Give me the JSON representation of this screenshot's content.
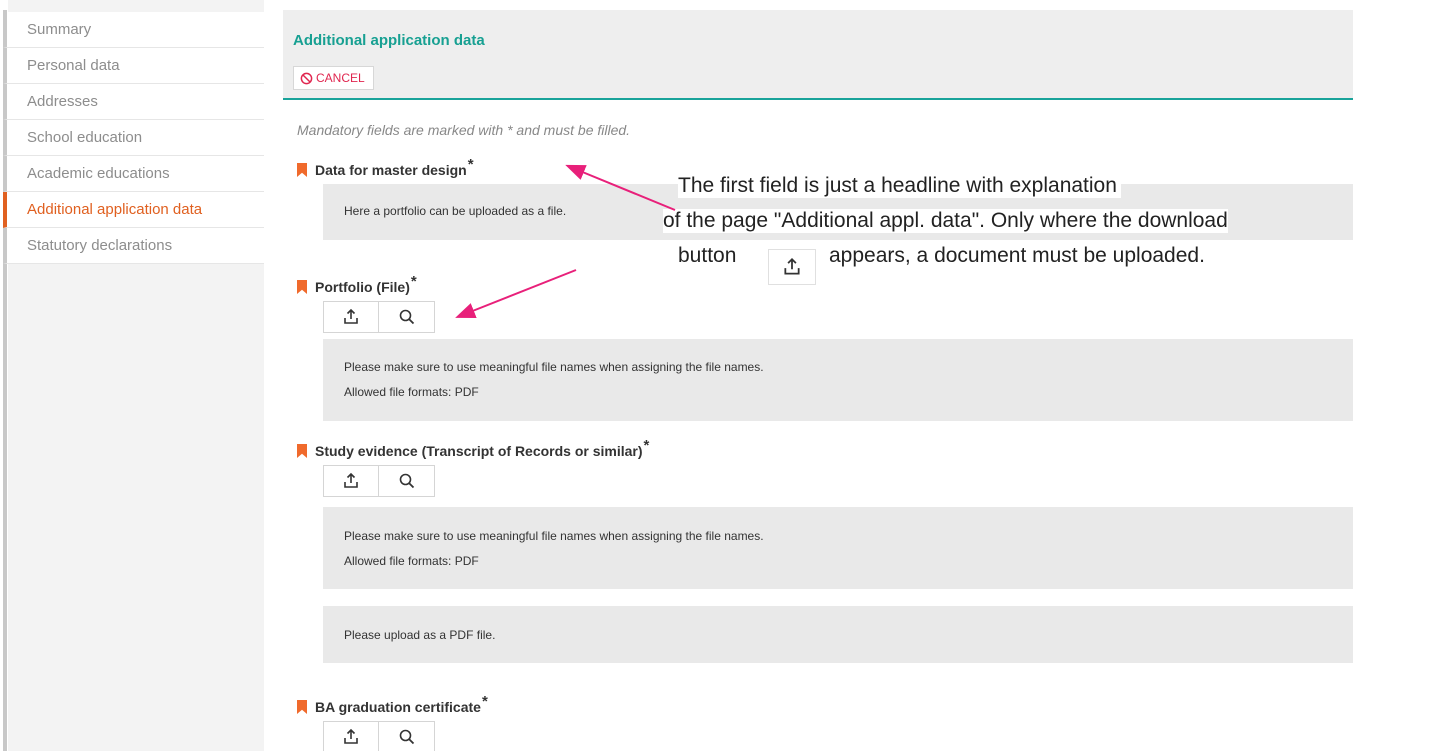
{
  "sidebar": {
    "items": [
      {
        "label": "Summary"
      },
      {
        "label": "Personal data"
      },
      {
        "label": "Addresses"
      },
      {
        "label": "School education"
      },
      {
        "label": "Academic educations"
      },
      {
        "label": "Additional application data",
        "active": true
      },
      {
        "label": "Statutory declarations"
      }
    ]
  },
  "header": {
    "title": "Additional application data",
    "cancel_label": "CANCEL"
  },
  "mandatory_note": "Mandatory fields are marked with * and must be filled.",
  "sections": [
    {
      "title": "Data for master design",
      "required": "*",
      "info": [
        "Here a portfolio can be uploaded as a file."
      ]
    },
    {
      "title": "Portfolio (File)",
      "required": "*",
      "info": [
        "Please make sure to use meaningful file names when assigning the file names.",
        "Allowed file formats: PDF"
      ]
    },
    {
      "title": "Study evidence (Transcript of Records or similar)",
      "required": "*",
      "info": [
        "Please make sure to use meaningful file names when assigning the file names.",
        "Allowed file formats: PDF"
      ],
      "info2": [
        "Please upload as a PDF file."
      ]
    },
    {
      "title": "BA graduation certificate",
      "required": "*"
    }
  ],
  "annotation": {
    "line1": "The first field is just a headline with explanation",
    "line2": "of the page \"Additional appl. data\". Only where the download",
    "line3_before": "button",
    "line3_after": "appears, a document must be uploaded."
  },
  "colors": {
    "accent_teal": "#17a092",
    "active_orange": "#e06020",
    "bookmark_orange": "#f06a2c",
    "cancel_red": "#e0264f",
    "arrow_pink": "#e8207a"
  },
  "icons": {
    "upload": "upload-icon",
    "search": "search-icon",
    "cancel": "ban-icon",
    "bookmark": "bookmark-icon"
  }
}
